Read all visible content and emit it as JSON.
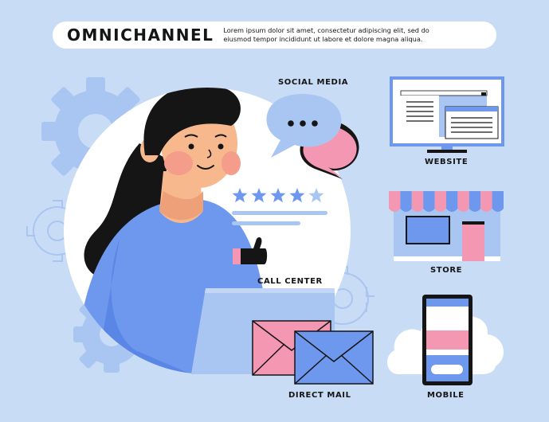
{
  "header": {
    "title": "OMNICHANNEL",
    "description_line1": "Lorem ipsum dolor sit amet, consectetur adipiscing elit, sed do",
    "description_line2": "eiusmod tempor incididunt ut labore et dolore magna aliqua."
  },
  "channels": {
    "social_media": "SOCIAL MEDIA",
    "website": "WEBSITE",
    "store": "STORE",
    "call_center": "CALL CENTER",
    "direct_mail": "DIRECT MAIL",
    "mobile": "MOBILE"
  },
  "rating": {
    "value": 4,
    "max": 5
  },
  "colors": {
    "background": "#c9dcf6",
    "blue": "#6e97ee",
    "light_blue": "#a9c6f2",
    "pink": "#f497b3",
    "skin": "#f7b88e",
    "dark": "#151515",
    "white": "#ffffff"
  },
  "icons": [
    "gear-icon",
    "speech-bubble-icon",
    "star-icon",
    "monitor-icon",
    "storefront-icon",
    "smartphone-icon",
    "envelope-icon",
    "cloud-icon",
    "thumbs-up-icon"
  ]
}
